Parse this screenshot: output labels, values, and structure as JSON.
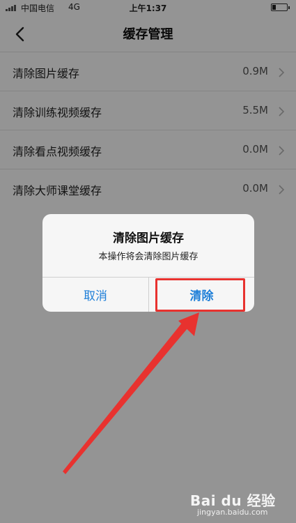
{
  "status_bar": {
    "carrier": "中国电信",
    "network": "4G",
    "time": "上午1:37"
  },
  "nav": {
    "title": "缓存管理",
    "back_icon": "chevron-left-icon"
  },
  "cache_items": [
    {
      "label": "清除图片缓存",
      "size": "0.9M"
    },
    {
      "label": "清除训练视频缓存",
      "size": "5.5M"
    },
    {
      "label": "清除看点视频缓存",
      "size": "0.0M"
    },
    {
      "label": "清除大师课堂缓存",
      "size": "0.0M"
    }
  ],
  "dialog": {
    "title": "清除图片缓存",
    "message": "本操作将会清除图片缓存",
    "cancel_label": "取消",
    "confirm_label": "清除"
  },
  "watermark": {
    "logo": "Bai du 经验",
    "url": "jingyan.baidu.com"
  },
  "colors": {
    "accent": "#1e7fd8",
    "annotation": "#e8322f"
  }
}
